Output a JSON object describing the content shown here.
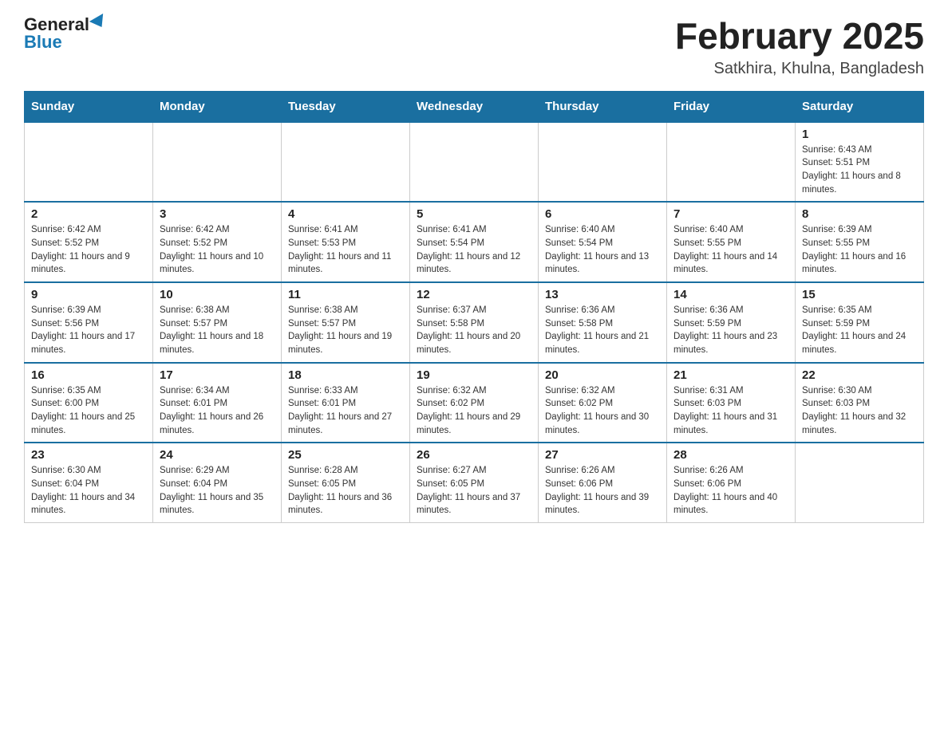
{
  "logo": {
    "general": "General",
    "blue": "Blue"
  },
  "header": {
    "month_year": "February 2025",
    "location": "Satkhira, Khulna, Bangladesh"
  },
  "weekdays": [
    "Sunday",
    "Monday",
    "Tuesday",
    "Wednesday",
    "Thursday",
    "Friday",
    "Saturday"
  ],
  "weeks": [
    [
      {
        "day": "",
        "info": ""
      },
      {
        "day": "",
        "info": ""
      },
      {
        "day": "",
        "info": ""
      },
      {
        "day": "",
        "info": ""
      },
      {
        "day": "",
        "info": ""
      },
      {
        "day": "",
        "info": ""
      },
      {
        "day": "1",
        "info": "Sunrise: 6:43 AM\nSunset: 5:51 PM\nDaylight: 11 hours and 8 minutes."
      }
    ],
    [
      {
        "day": "2",
        "info": "Sunrise: 6:42 AM\nSunset: 5:52 PM\nDaylight: 11 hours and 9 minutes."
      },
      {
        "day": "3",
        "info": "Sunrise: 6:42 AM\nSunset: 5:52 PM\nDaylight: 11 hours and 10 minutes."
      },
      {
        "day": "4",
        "info": "Sunrise: 6:41 AM\nSunset: 5:53 PM\nDaylight: 11 hours and 11 minutes."
      },
      {
        "day": "5",
        "info": "Sunrise: 6:41 AM\nSunset: 5:54 PM\nDaylight: 11 hours and 12 minutes."
      },
      {
        "day": "6",
        "info": "Sunrise: 6:40 AM\nSunset: 5:54 PM\nDaylight: 11 hours and 13 minutes."
      },
      {
        "day": "7",
        "info": "Sunrise: 6:40 AM\nSunset: 5:55 PM\nDaylight: 11 hours and 14 minutes."
      },
      {
        "day": "8",
        "info": "Sunrise: 6:39 AM\nSunset: 5:55 PM\nDaylight: 11 hours and 16 minutes."
      }
    ],
    [
      {
        "day": "9",
        "info": "Sunrise: 6:39 AM\nSunset: 5:56 PM\nDaylight: 11 hours and 17 minutes."
      },
      {
        "day": "10",
        "info": "Sunrise: 6:38 AM\nSunset: 5:57 PM\nDaylight: 11 hours and 18 minutes."
      },
      {
        "day": "11",
        "info": "Sunrise: 6:38 AM\nSunset: 5:57 PM\nDaylight: 11 hours and 19 minutes."
      },
      {
        "day": "12",
        "info": "Sunrise: 6:37 AM\nSunset: 5:58 PM\nDaylight: 11 hours and 20 minutes."
      },
      {
        "day": "13",
        "info": "Sunrise: 6:36 AM\nSunset: 5:58 PM\nDaylight: 11 hours and 21 minutes."
      },
      {
        "day": "14",
        "info": "Sunrise: 6:36 AM\nSunset: 5:59 PM\nDaylight: 11 hours and 23 minutes."
      },
      {
        "day": "15",
        "info": "Sunrise: 6:35 AM\nSunset: 5:59 PM\nDaylight: 11 hours and 24 minutes."
      }
    ],
    [
      {
        "day": "16",
        "info": "Sunrise: 6:35 AM\nSunset: 6:00 PM\nDaylight: 11 hours and 25 minutes."
      },
      {
        "day": "17",
        "info": "Sunrise: 6:34 AM\nSunset: 6:01 PM\nDaylight: 11 hours and 26 minutes."
      },
      {
        "day": "18",
        "info": "Sunrise: 6:33 AM\nSunset: 6:01 PM\nDaylight: 11 hours and 27 minutes."
      },
      {
        "day": "19",
        "info": "Sunrise: 6:32 AM\nSunset: 6:02 PM\nDaylight: 11 hours and 29 minutes."
      },
      {
        "day": "20",
        "info": "Sunrise: 6:32 AM\nSunset: 6:02 PM\nDaylight: 11 hours and 30 minutes."
      },
      {
        "day": "21",
        "info": "Sunrise: 6:31 AM\nSunset: 6:03 PM\nDaylight: 11 hours and 31 minutes."
      },
      {
        "day": "22",
        "info": "Sunrise: 6:30 AM\nSunset: 6:03 PM\nDaylight: 11 hours and 32 minutes."
      }
    ],
    [
      {
        "day": "23",
        "info": "Sunrise: 6:30 AM\nSunset: 6:04 PM\nDaylight: 11 hours and 34 minutes."
      },
      {
        "day": "24",
        "info": "Sunrise: 6:29 AM\nSunset: 6:04 PM\nDaylight: 11 hours and 35 minutes."
      },
      {
        "day": "25",
        "info": "Sunrise: 6:28 AM\nSunset: 6:05 PM\nDaylight: 11 hours and 36 minutes."
      },
      {
        "day": "26",
        "info": "Sunrise: 6:27 AM\nSunset: 6:05 PM\nDaylight: 11 hours and 37 minutes."
      },
      {
        "day": "27",
        "info": "Sunrise: 6:26 AM\nSunset: 6:06 PM\nDaylight: 11 hours and 39 minutes."
      },
      {
        "day": "28",
        "info": "Sunrise: 6:26 AM\nSunset: 6:06 PM\nDaylight: 11 hours and 40 minutes."
      },
      {
        "day": "",
        "info": ""
      }
    ]
  ]
}
